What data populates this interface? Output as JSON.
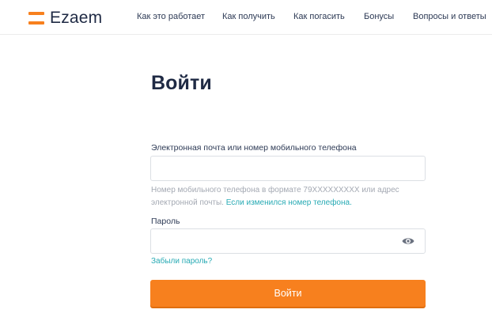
{
  "brand": {
    "name": "Ezaem",
    "color": "#f7801e"
  },
  "nav": {
    "items": [
      "Как это работает",
      "Как получить",
      "Как погасить",
      "Бонусы",
      "Вопросы и ответы"
    ]
  },
  "login": {
    "title": "Войти",
    "email_label": "Электронная почта или номер мобильного телефона",
    "email_value": "",
    "hint_text": "Номер мобильного телефона в формате 79XXXXXXXXX или адрес электронной почты.",
    "hint_link": "Если изменился номер телефона.",
    "password_label": "Пароль",
    "password_value": "",
    "password_toggle_icon": "eye-icon",
    "forgot_link": "Забыли пароль?",
    "submit_label": "Войти"
  },
  "colors": {
    "accent": "#f7801e",
    "link": "#27aab4",
    "text": "#1f2a44",
    "hint": "#a4a9b3"
  }
}
